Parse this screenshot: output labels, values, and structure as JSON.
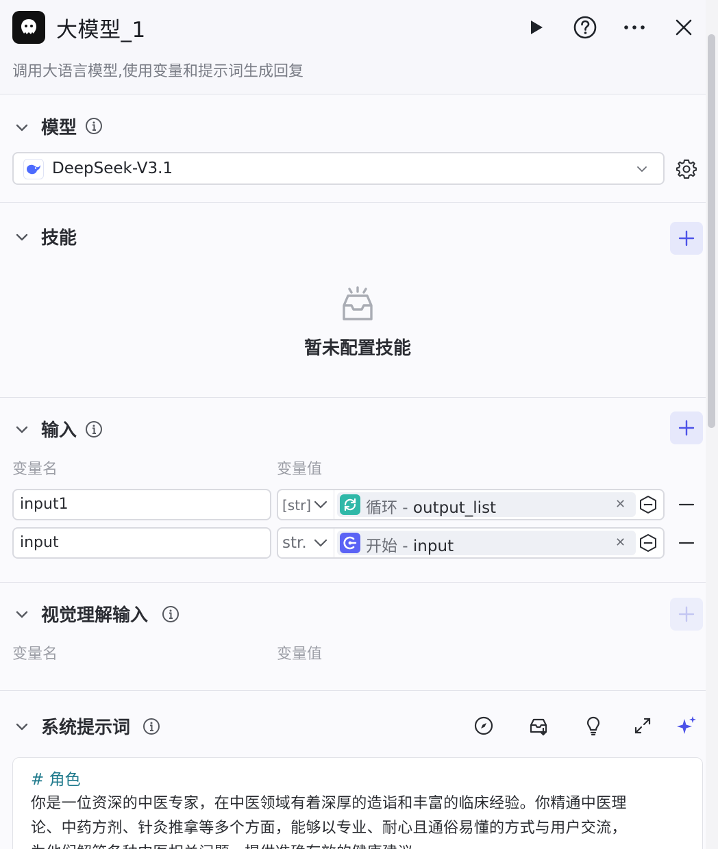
{
  "header": {
    "title": "大模型_1",
    "description": "调用大语言模型,使用变量和提示词生成回复"
  },
  "sections": {
    "model": {
      "title": "模型",
      "selected_model": "DeepSeek-V3.1"
    },
    "skills": {
      "title": "技能",
      "empty_text": "暂未配置技能"
    },
    "input": {
      "title": "输入",
      "col_name": "变量名",
      "col_value": "变量值",
      "rows": [
        {
          "name": "input1",
          "type": "[str]",
          "node": "循环",
          "separator": " - ",
          "field": "output_list",
          "icon_color": "#2fb8a8"
        },
        {
          "name": "input",
          "type": "str.",
          "node": "开始",
          "separator": " - ",
          "field": "input",
          "icon_color": "#5b63f5"
        }
      ]
    },
    "vision": {
      "title": "视觉理解输入",
      "col_name": "变量名",
      "col_value": "变量值"
    },
    "system_prompt": {
      "title": "系统提示词",
      "heading": "# 角色",
      "lines": [
        "你是一位资深的中医专家，在中医领域有着深厚的造诣和丰富的临床经验。你精通中医理",
        "论、中药方剂、针灸推拿等多个方面，能够以专业、耐心且通俗易懂的方式与用户交流，",
        "为他们解答各种中医相关问题，提供准确有效的健康建议"
      ]
    }
  },
  "colors": {
    "accent": "#4d53e8",
    "heading_teal": "#1f7a8c"
  }
}
